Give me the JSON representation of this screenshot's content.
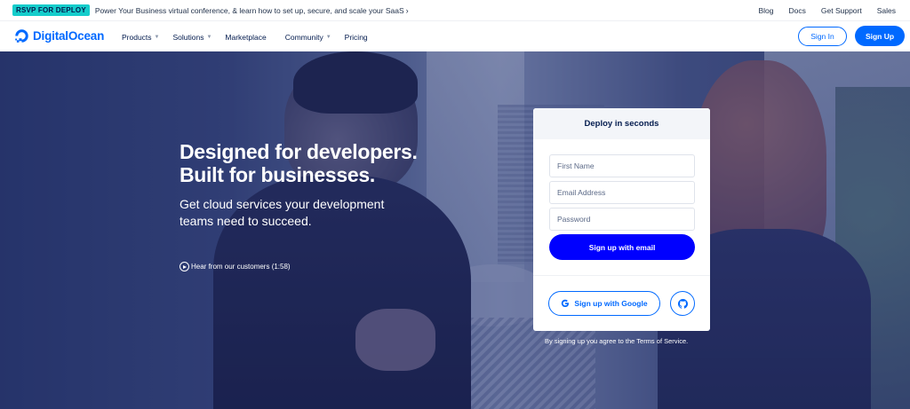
{
  "topbar": {
    "badge": "RSVP FOR DEPLOY",
    "promo": "Power Your Business virtual conference, & learn how to set up, secure, and scale your SaaS",
    "promo_icon": "chevron-right-icon",
    "links": [
      "Blog",
      "Docs",
      "Get Support",
      "Sales"
    ]
  },
  "nav": {
    "brand": "DigitalOcean",
    "menu": [
      {
        "label": "Products",
        "dropdown": true
      },
      {
        "label": "Solutions",
        "dropdown": true
      },
      {
        "label": "Marketplace",
        "dropdown": false
      },
      {
        "label": "Community",
        "dropdown": true
      },
      {
        "label": "Pricing",
        "dropdown": false
      }
    ],
    "sign_in": "Sign In",
    "sign_up": "Sign Up"
  },
  "hero": {
    "headline_1": "Designed for developers.",
    "headline_2": "Built for businesses.",
    "subhead": "Get cloud services your development teams need to succeed.",
    "video_link": "Hear from our customers (1:58)"
  },
  "signup_card": {
    "title": "Deploy in seconds",
    "first_name_placeholder": "First Name",
    "email_placeholder": "Email Address",
    "password_placeholder": "Password",
    "email_button": "Sign up with email",
    "google_button": "Sign up with Google",
    "github_icon": "github-icon",
    "terms": "By signing up you agree to the Terms of Service."
  },
  "colors": {
    "brand_blue": "#0069ff",
    "cta_blue": "#0000ff",
    "badge_teal": "#15cdcb",
    "text_dark": "#031b4e"
  }
}
